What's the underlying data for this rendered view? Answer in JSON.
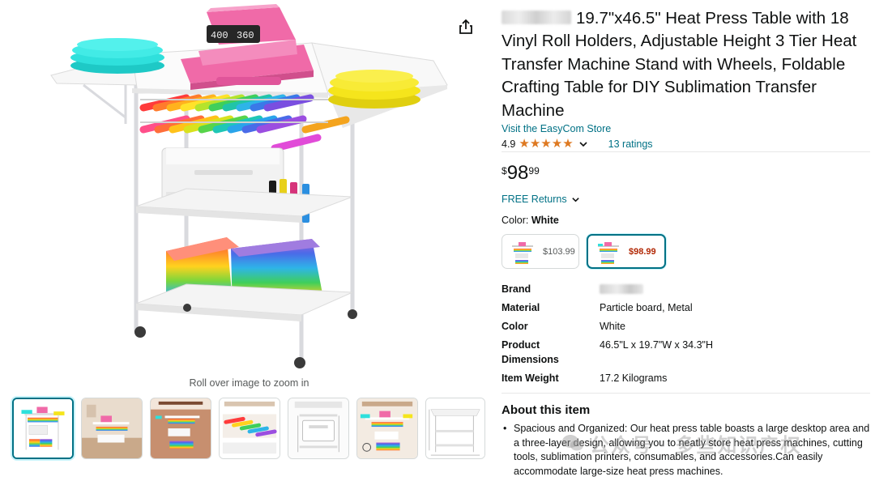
{
  "product": {
    "title": "19.7\"x46.5\" Heat Press Table with 18 Vinyl Roll Holders, Adjustable Height 3 Tier Heat Transfer Machine Stand with Wheels, Foldable Crafting Table for DIY Sublimation Transfer Machine",
    "store_link": "Visit the EasyCom Store",
    "rating_value": "4.9",
    "rating_stars": 5,
    "ratings_count": "13 ratings",
    "price": {
      "symbol": "$",
      "whole": "98",
      "fraction": "99"
    },
    "returns_label": "FREE Returns",
    "color_label": "Color:",
    "color_value": "White",
    "variants": [
      {
        "price": "$103.99",
        "selected": false
      },
      {
        "price": "$98.99",
        "selected": true
      }
    ]
  },
  "specs": [
    {
      "key": "Brand",
      "value": ""
    },
    {
      "key": "Material",
      "value": "Particle board, Metal"
    },
    {
      "key": "Color",
      "value": "White"
    },
    {
      "key": "Product Dimensions",
      "value": "46.5\"L x 19.7\"W x 34.3\"H"
    },
    {
      "key": "Item Weight",
      "value": "17.2 Kilograms"
    }
  ],
  "about": {
    "heading": "About this item",
    "bullets": [
      "Spacious and Organized: Our heat press table boasts a large desktop area and a three-layer design, allowing you to neatly store heat press machines, cutting tools, sublimation printers, consumables, and accessories.Can easily accommodate large-size heat press machines."
    ]
  },
  "gallery": {
    "zoom_hint": "Roll over image to zoom in",
    "press_display": [
      "400",
      "360"
    ],
    "thumbnail_count": 7,
    "active_thumbnail": 0
  },
  "watermark": "公众号 · 多些知识产权",
  "colors": {
    "link": "#007185",
    "star": "#de7921",
    "sale_price": "#b12704",
    "press_pink": "#f06aa8",
    "shirt_cyan": "#2fe0dc",
    "shirt_yellow": "#f5e51c"
  }
}
